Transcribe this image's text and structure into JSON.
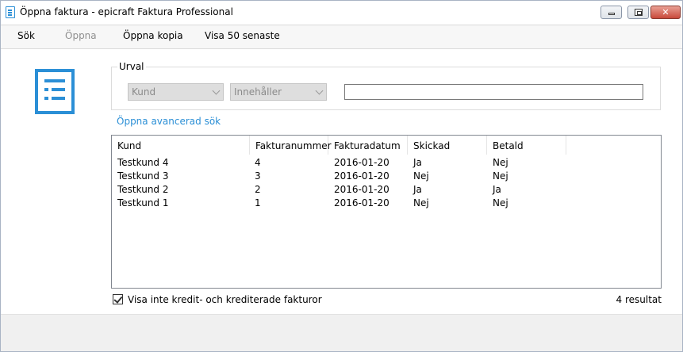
{
  "window": {
    "title": "Öppna faktura - epicraft Faktura Professional"
  },
  "menu": [
    {
      "label": "Sök",
      "disabled": false
    },
    {
      "label": "Öppna",
      "disabled": true
    },
    {
      "label": "Öppna kopia",
      "disabled": false
    },
    {
      "label": "Visa 50 senaste",
      "disabled": false
    }
  ],
  "filter": {
    "legend": "Urval",
    "field_select": "Kund",
    "operator_select": "Innehåller",
    "search_value": ""
  },
  "advanced_link": "Öppna avancerad sök",
  "invoice_list": {
    "columns": [
      "Kund",
      "Fakturanummer",
      "Fakturadatum",
      "Skickad",
      "Betald"
    ],
    "rows": [
      [
        "Testkund 4",
        "4",
        "2016-01-20",
        "Ja",
        "Nej"
      ],
      [
        "Testkund 3",
        "3",
        "2016-01-20",
        "Nej",
        "Nej"
      ],
      [
        "Testkund 2",
        "2",
        "2016-01-20",
        "Ja",
        "Ja"
      ],
      [
        "Testkund 1",
        "1",
        "2016-01-20",
        "Nej",
        "Nej"
      ]
    ]
  },
  "exclude_credit": {
    "label": "Visa inte kredit- och krediterade fakturor",
    "checked": true
  },
  "result_count": "4  resultat",
  "colors": {
    "accent": "#2b8fd6",
    "link": "#2b8fd6",
    "disabled_text": "#8f8f8f"
  }
}
